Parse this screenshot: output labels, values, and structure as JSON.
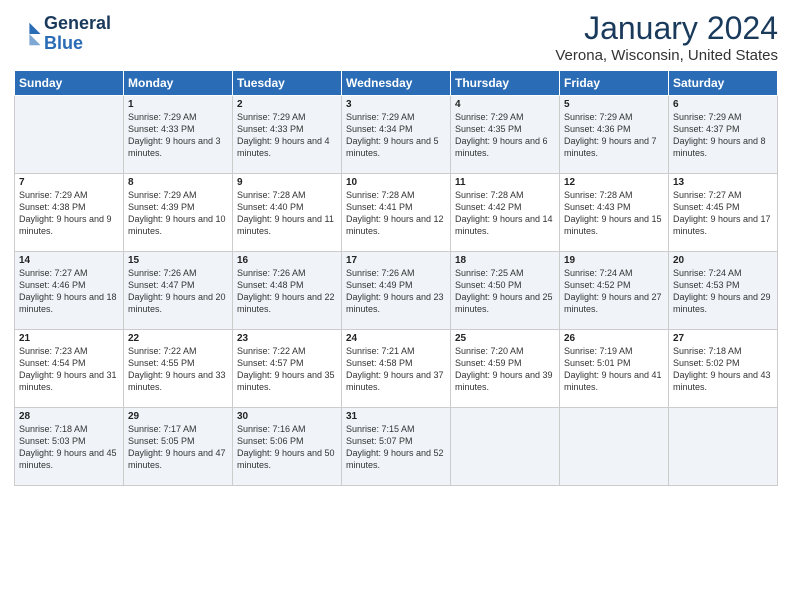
{
  "header": {
    "logo_line1": "General",
    "logo_line2": "Blue",
    "title": "January 2024",
    "subtitle": "Verona, Wisconsin, United States"
  },
  "days_of_week": [
    "Sunday",
    "Monday",
    "Tuesday",
    "Wednesday",
    "Thursday",
    "Friday",
    "Saturday"
  ],
  "weeks": [
    [
      {
        "num": "",
        "sunrise": "",
        "sunset": "",
        "daylight": ""
      },
      {
        "num": "1",
        "sunrise": "Sunrise: 7:29 AM",
        "sunset": "Sunset: 4:33 PM",
        "daylight": "Daylight: 9 hours and 3 minutes."
      },
      {
        "num": "2",
        "sunrise": "Sunrise: 7:29 AM",
        "sunset": "Sunset: 4:33 PM",
        "daylight": "Daylight: 9 hours and 4 minutes."
      },
      {
        "num": "3",
        "sunrise": "Sunrise: 7:29 AM",
        "sunset": "Sunset: 4:34 PM",
        "daylight": "Daylight: 9 hours and 5 minutes."
      },
      {
        "num": "4",
        "sunrise": "Sunrise: 7:29 AM",
        "sunset": "Sunset: 4:35 PM",
        "daylight": "Daylight: 9 hours and 6 minutes."
      },
      {
        "num": "5",
        "sunrise": "Sunrise: 7:29 AM",
        "sunset": "Sunset: 4:36 PM",
        "daylight": "Daylight: 9 hours and 7 minutes."
      },
      {
        "num": "6",
        "sunrise": "Sunrise: 7:29 AM",
        "sunset": "Sunset: 4:37 PM",
        "daylight": "Daylight: 9 hours and 8 minutes."
      }
    ],
    [
      {
        "num": "7",
        "sunrise": "Sunrise: 7:29 AM",
        "sunset": "Sunset: 4:38 PM",
        "daylight": "Daylight: 9 hours and 9 minutes."
      },
      {
        "num": "8",
        "sunrise": "Sunrise: 7:29 AM",
        "sunset": "Sunset: 4:39 PM",
        "daylight": "Daylight: 9 hours and 10 minutes."
      },
      {
        "num": "9",
        "sunrise": "Sunrise: 7:28 AM",
        "sunset": "Sunset: 4:40 PM",
        "daylight": "Daylight: 9 hours and 11 minutes."
      },
      {
        "num": "10",
        "sunrise": "Sunrise: 7:28 AM",
        "sunset": "Sunset: 4:41 PM",
        "daylight": "Daylight: 9 hours and 12 minutes."
      },
      {
        "num": "11",
        "sunrise": "Sunrise: 7:28 AM",
        "sunset": "Sunset: 4:42 PM",
        "daylight": "Daylight: 9 hours and 14 minutes."
      },
      {
        "num": "12",
        "sunrise": "Sunrise: 7:28 AM",
        "sunset": "Sunset: 4:43 PM",
        "daylight": "Daylight: 9 hours and 15 minutes."
      },
      {
        "num": "13",
        "sunrise": "Sunrise: 7:27 AM",
        "sunset": "Sunset: 4:45 PM",
        "daylight": "Daylight: 9 hours and 17 minutes."
      }
    ],
    [
      {
        "num": "14",
        "sunrise": "Sunrise: 7:27 AM",
        "sunset": "Sunset: 4:46 PM",
        "daylight": "Daylight: 9 hours and 18 minutes."
      },
      {
        "num": "15",
        "sunrise": "Sunrise: 7:26 AM",
        "sunset": "Sunset: 4:47 PM",
        "daylight": "Daylight: 9 hours and 20 minutes."
      },
      {
        "num": "16",
        "sunrise": "Sunrise: 7:26 AM",
        "sunset": "Sunset: 4:48 PM",
        "daylight": "Daylight: 9 hours and 22 minutes."
      },
      {
        "num": "17",
        "sunrise": "Sunrise: 7:26 AM",
        "sunset": "Sunset: 4:49 PM",
        "daylight": "Daylight: 9 hours and 23 minutes."
      },
      {
        "num": "18",
        "sunrise": "Sunrise: 7:25 AM",
        "sunset": "Sunset: 4:50 PM",
        "daylight": "Daylight: 9 hours and 25 minutes."
      },
      {
        "num": "19",
        "sunrise": "Sunrise: 7:24 AM",
        "sunset": "Sunset: 4:52 PM",
        "daylight": "Daylight: 9 hours and 27 minutes."
      },
      {
        "num": "20",
        "sunrise": "Sunrise: 7:24 AM",
        "sunset": "Sunset: 4:53 PM",
        "daylight": "Daylight: 9 hours and 29 minutes."
      }
    ],
    [
      {
        "num": "21",
        "sunrise": "Sunrise: 7:23 AM",
        "sunset": "Sunset: 4:54 PM",
        "daylight": "Daylight: 9 hours and 31 minutes."
      },
      {
        "num": "22",
        "sunrise": "Sunrise: 7:22 AM",
        "sunset": "Sunset: 4:55 PM",
        "daylight": "Daylight: 9 hours and 33 minutes."
      },
      {
        "num": "23",
        "sunrise": "Sunrise: 7:22 AM",
        "sunset": "Sunset: 4:57 PM",
        "daylight": "Daylight: 9 hours and 35 minutes."
      },
      {
        "num": "24",
        "sunrise": "Sunrise: 7:21 AM",
        "sunset": "Sunset: 4:58 PM",
        "daylight": "Daylight: 9 hours and 37 minutes."
      },
      {
        "num": "25",
        "sunrise": "Sunrise: 7:20 AM",
        "sunset": "Sunset: 4:59 PM",
        "daylight": "Daylight: 9 hours and 39 minutes."
      },
      {
        "num": "26",
        "sunrise": "Sunrise: 7:19 AM",
        "sunset": "Sunset: 5:01 PM",
        "daylight": "Daylight: 9 hours and 41 minutes."
      },
      {
        "num": "27",
        "sunrise": "Sunrise: 7:18 AM",
        "sunset": "Sunset: 5:02 PM",
        "daylight": "Daylight: 9 hours and 43 minutes."
      }
    ],
    [
      {
        "num": "28",
        "sunrise": "Sunrise: 7:18 AM",
        "sunset": "Sunset: 5:03 PM",
        "daylight": "Daylight: 9 hours and 45 minutes."
      },
      {
        "num": "29",
        "sunrise": "Sunrise: 7:17 AM",
        "sunset": "Sunset: 5:05 PM",
        "daylight": "Daylight: 9 hours and 47 minutes."
      },
      {
        "num": "30",
        "sunrise": "Sunrise: 7:16 AM",
        "sunset": "Sunset: 5:06 PM",
        "daylight": "Daylight: 9 hours and 50 minutes."
      },
      {
        "num": "31",
        "sunrise": "Sunrise: 7:15 AM",
        "sunset": "Sunset: 5:07 PM",
        "daylight": "Daylight: 9 hours and 52 minutes."
      },
      {
        "num": "",
        "sunrise": "",
        "sunset": "",
        "daylight": ""
      },
      {
        "num": "",
        "sunrise": "",
        "sunset": "",
        "daylight": ""
      },
      {
        "num": "",
        "sunrise": "",
        "sunset": "",
        "daylight": ""
      }
    ]
  ]
}
